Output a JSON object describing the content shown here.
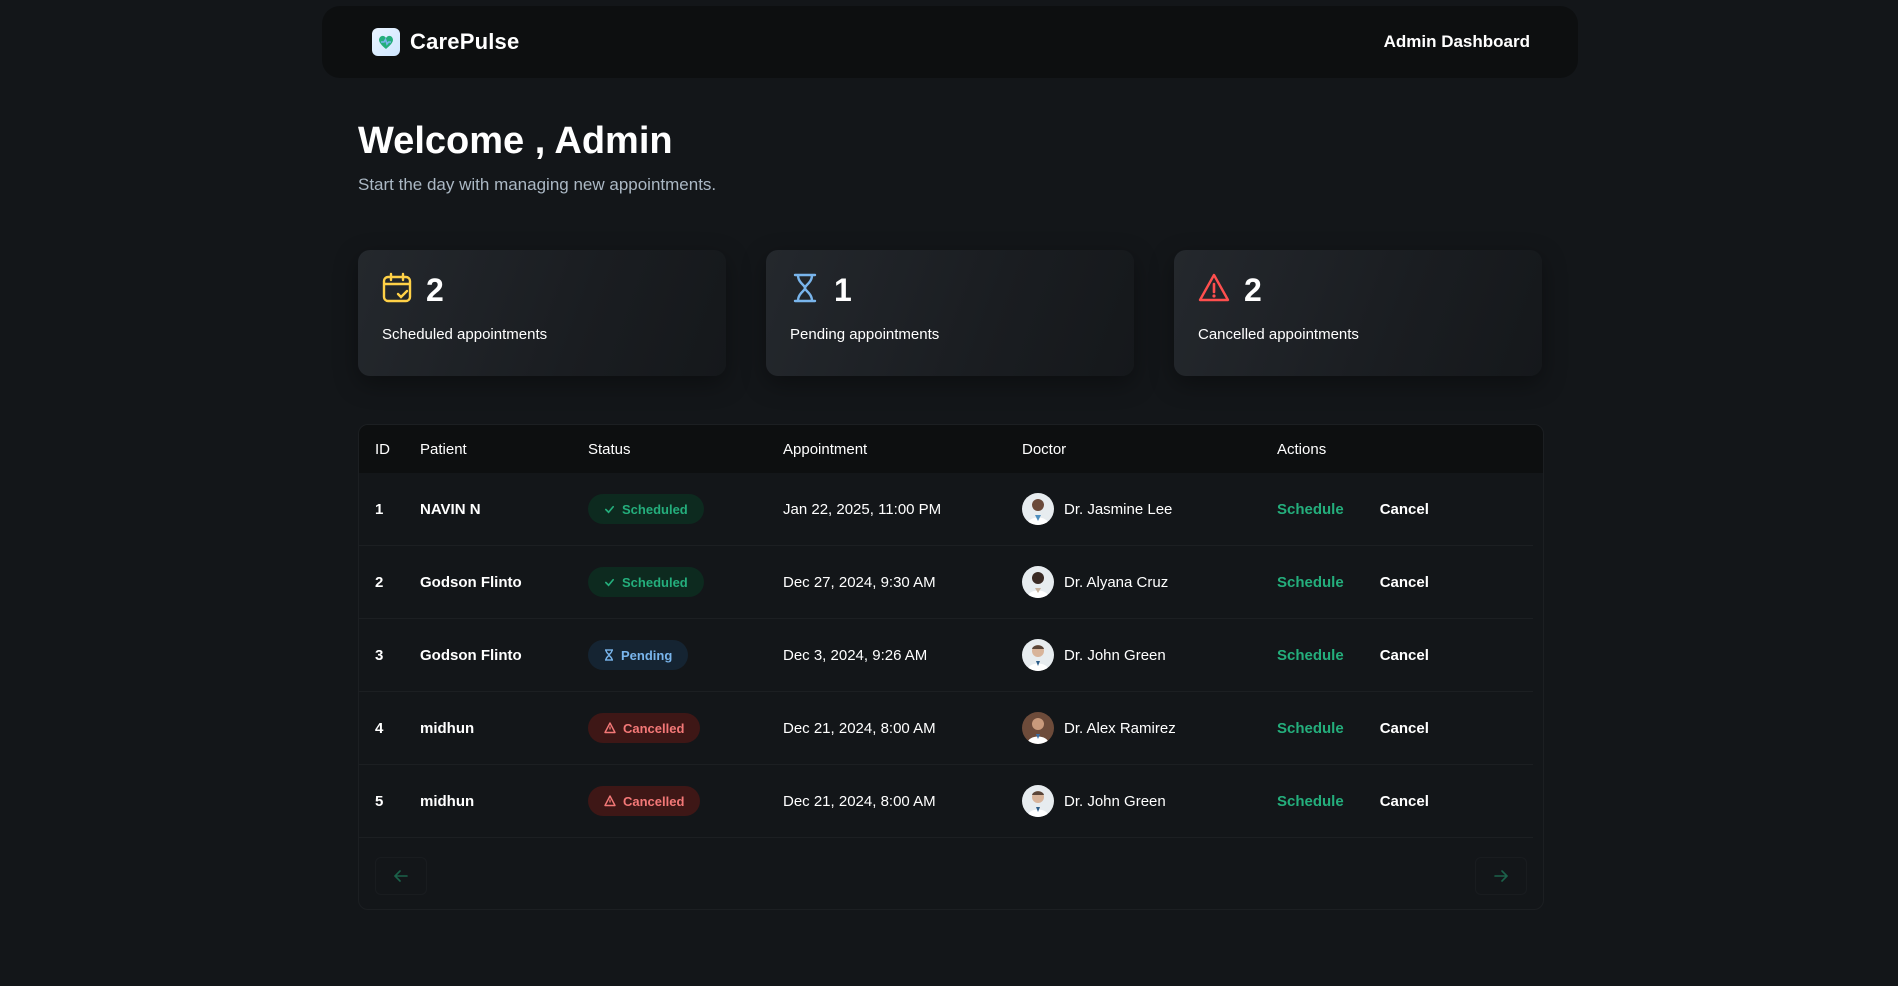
{
  "header": {
    "brand": "CarePulse",
    "admin_label": "Admin Dashboard"
  },
  "welcome": {
    "title": "Welcome , Admin",
    "subtitle": "Start the day with managing new appointments."
  },
  "stats": [
    {
      "icon": "calendar-check-icon",
      "count": "2",
      "label": "Scheduled appointments",
      "color": "#ffd147"
    },
    {
      "icon": "hourglass-icon",
      "count": "1",
      "label": "Pending appointments",
      "color": "#79b5ec"
    },
    {
      "icon": "warning-icon",
      "count": "2",
      "label": "Cancelled appointments",
      "color": "#ff4f4e"
    }
  ],
  "table": {
    "headers": [
      "ID",
      "Patient",
      "Status",
      "Appointment",
      "Doctor",
      "Actions"
    ],
    "rows": [
      {
        "id": "1",
        "patient": "NAVIN N",
        "status": "Scheduled",
        "appointment": "Jan 22, 2025, 11:00 PM",
        "doctor": "Dr. Jasmine Lee",
        "schedule": "Schedule",
        "cancel": "Cancel"
      },
      {
        "id": "2",
        "patient": "Godson Flinto",
        "status": "Scheduled",
        "appointment": "Dec 27, 2024, 9:30 AM",
        "doctor": "Dr. Alyana Cruz",
        "schedule": "Schedule",
        "cancel": "Cancel"
      },
      {
        "id": "3",
        "patient": "Godson Flinto",
        "status": "Pending",
        "appointment": "Dec 3, 2024, 9:26 AM",
        "doctor": "Dr. John Green",
        "schedule": "Schedule",
        "cancel": "Cancel"
      },
      {
        "id": "4",
        "patient": "midhun",
        "status": "Cancelled",
        "appointment": "Dec 21, 2024, 8:00 AM",
        "doctor": "Dr. Alex Ramirez",
        "schedule": "Schedule",
        "cancel": "Cancel"
      },
      {
        "id": "5",
        "patient": "midhun",
        "status": "Cancelled",
        "appointment": "Dec 21, 2024, 8:00 AM",
        "doctor": "Dr. John Green",
        "schedule": "Schedule",
        "cancel": "Cancel"
      }
    ]
  },
  "pagination": {
    "prev_icon": "arrow-left-icon",
    "next_icon": "arrow-right-icon"
  },
  "colors": {
    "accent_green": "#24ae7c",
    "pending_blue": "#79b5ec",
    "cancel_red": "#f37877",
    "scheduled_yellow": "#ffd147"
  }
}
